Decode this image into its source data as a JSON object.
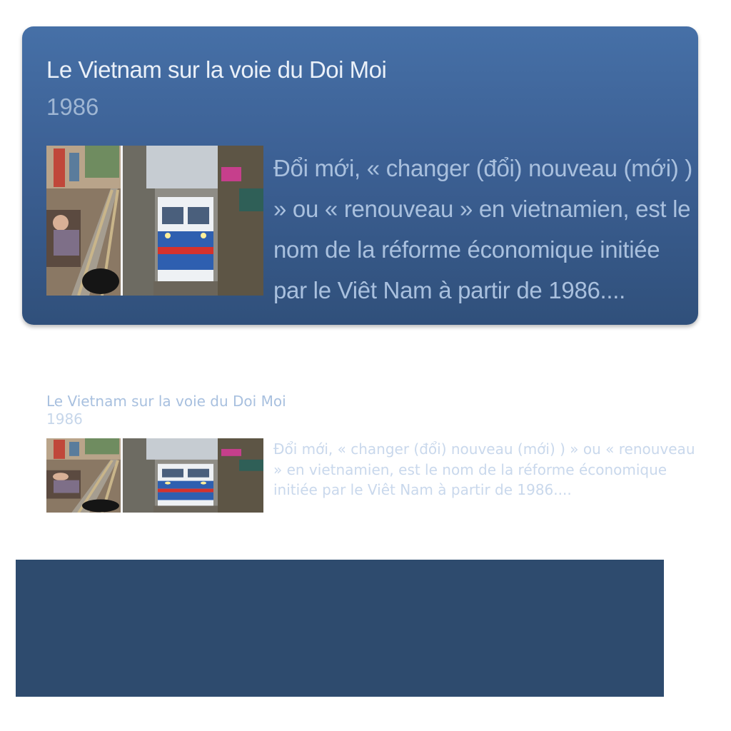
{
  "card": {
    "title": "Le Vietnam sur la voie du Doi Moi",
    "year": "1986",
    "description": "Đổi mới, « changer (đổi) nouveau (mới) ) » ou « renouveau » en vietnamien, est le nom de la réforme économique initiée par le Viêt Nam à partir de 1986....",
    "image_icon": "train-street-photo"
  },
  "reflection": {
    "title": "Le Vietnam sur la voie du Doi Moi",
    "year": "1986",
    "description": "Đổi mới, « changer (đổi) nouveau (mới) ) » ou « renouveau » en vietnamien, est le nom de la réforme économique initiée par le Viêt Nam à partir de 1986...."
  },
  "colors": {
    "card_top": "#4670a7",
    "card_bottom": "#30507b",
    "dark_block": "#2e4b6e"
  }
}
